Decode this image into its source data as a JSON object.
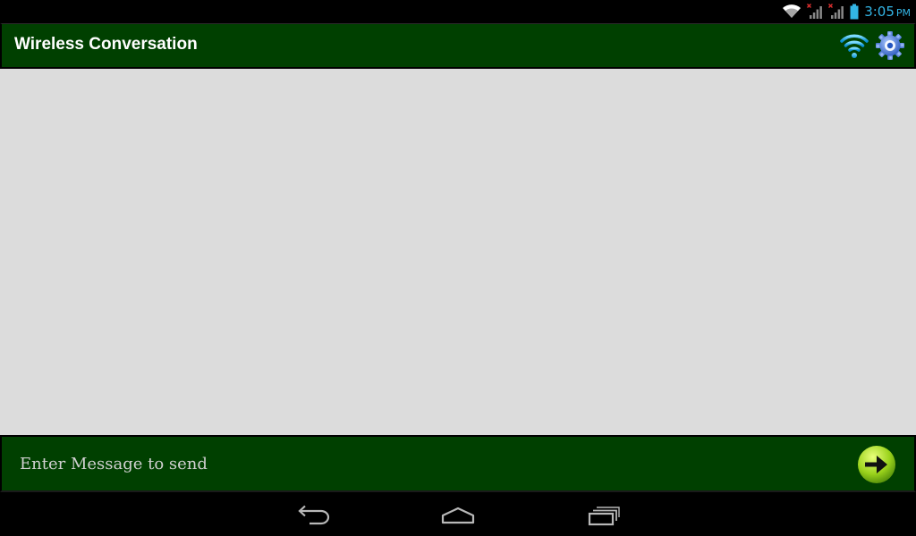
{
  "status_bar": {
    "time": "3:05",
    "ampm": "PM",
    "icons": [
      "wifi-signal-icon",
      "cell-signal-no-sim-icon",
      "cell-signal-no-sim-icon",
      "battery-icon"
    ]
  },
  "action_bar": {
    "title": "Wireless Conversation",
    "icons": [
      "wifi-icon",
      "settings-gear-icon"
    ]
  },
  "compose": {
    "placeholder": "Enter Message to send",
    "value": "",
    "send_icon": "send-arrow-icon"
  },
  "nav_bar": {
    "buttons": [
      "back-icon",
      "home-icon",
      "recent-apps-icon"
    ]
  },
  "colors": {
    "bar_green": "#004000",
    "conversation_bg": "#dcdcdc",
    "clock_blue": "#33b5e5",
    "send_green": "#9ad21b"
  }
}
